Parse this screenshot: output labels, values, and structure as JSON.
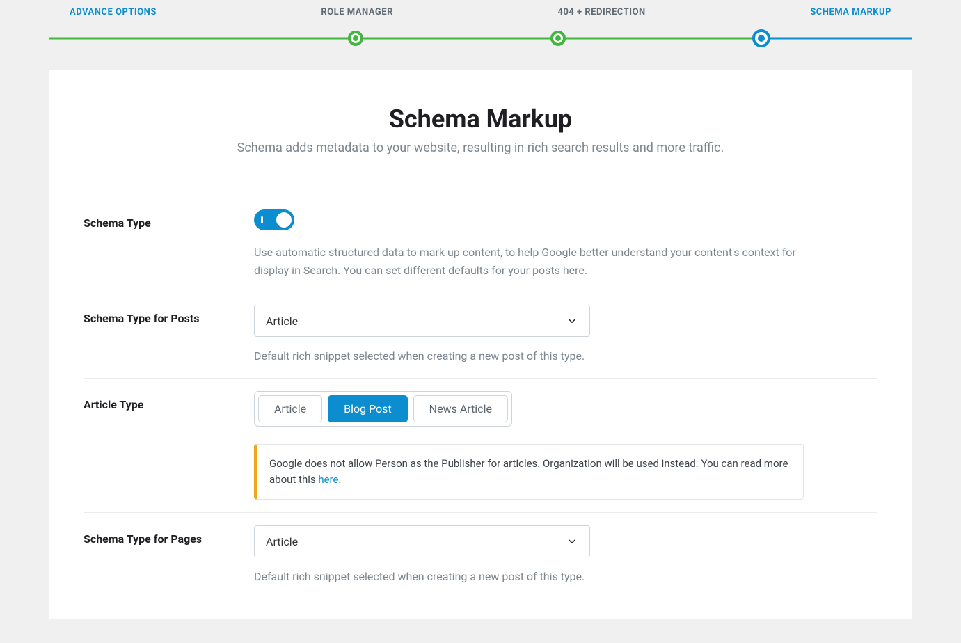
{
  "stepper": {
    "steps": [
      {
        "label": "ADVANCE OPTIONS",
        "state": "active"
      },
      {
        "label": "ROLE MANAGER",
        "state": "completed"
      },
      {
        "label": "404 + REDIRECTION",
        "state": "completed"
      },
      {
        "label": "SCHEMA MARKUP",
        "state": "current"
      }
    ]
  },
  "page": {
    "title": "Schema Markup",
    "subtitle": "Schema adds metadata to your website, resulting in rich search results and more traffic."
  },
  "schemaType": {
    "label": "Schema Type",
    "enabled": true,
    "hint": "Use automatic structured data to mark up content, to help Google better understand your content's context for display in Search. You can set different defaults for your posts here."
  },
  "postsSchema": {
    "label": "Schema Type for Posts",
    "value": "Article",
    "hint": "Default rich snippet selected when creating a new post of this type."
  },
  "articleType": {
    "label": "Article Type",
    "options": [
      "Article",
      "Blog Post",
      "News Article"
    ],
    "selected": "Blog Post",
    "noticeText": "Google does not allow Person as the Publisher for articles. Organization will be used instead. You can read more about this ",
    "noticeLink": "here",
    "noticePeriod": "."
  },
  "pagesSchema": {
    "label": "Schema Type for Pages",
    "value": "Article",
    "hint": "Default rich snippet selected when creating a new post of this type."
  }
}
